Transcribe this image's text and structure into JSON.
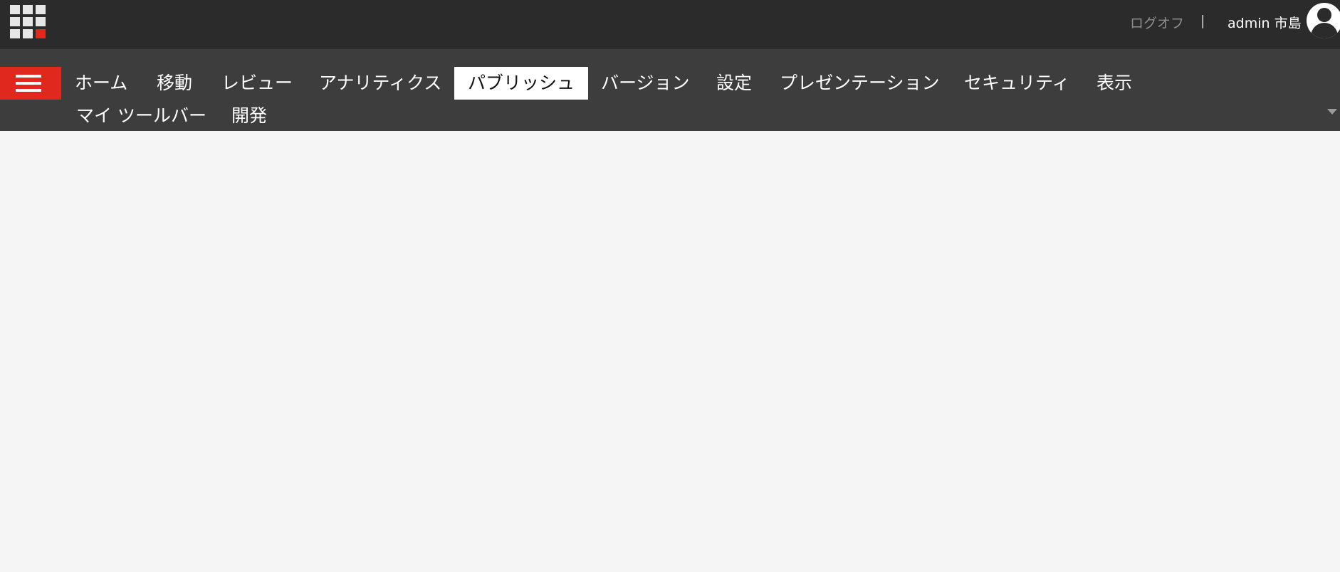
{
  "header": {
    "logoff": "ログオフ",
    "separator": "|",
    "user": "admin 市島"
  },
  "menu": {
    "row1": [
      "ホーム",
      "移動",
      "レビュー",
      "アナリティクス",
      "パブリッシュ",
      "バージョン",
      "設定",
      "プレゼンテーション",
      "セキュリティ",
      "表示"
    ],
    "row2": [
      "マイ ツールバー",
      "開発"
    ],
    "active": "パブリッシュ"
  },
  "colors": {
    "accent_red": "#e0281f",
    "topbar": "#2b2b2b",
    "menubar": "#3d3d3d",
    "link": "#2a84c6",
    "selection": "#cde6f7"
  }
}
